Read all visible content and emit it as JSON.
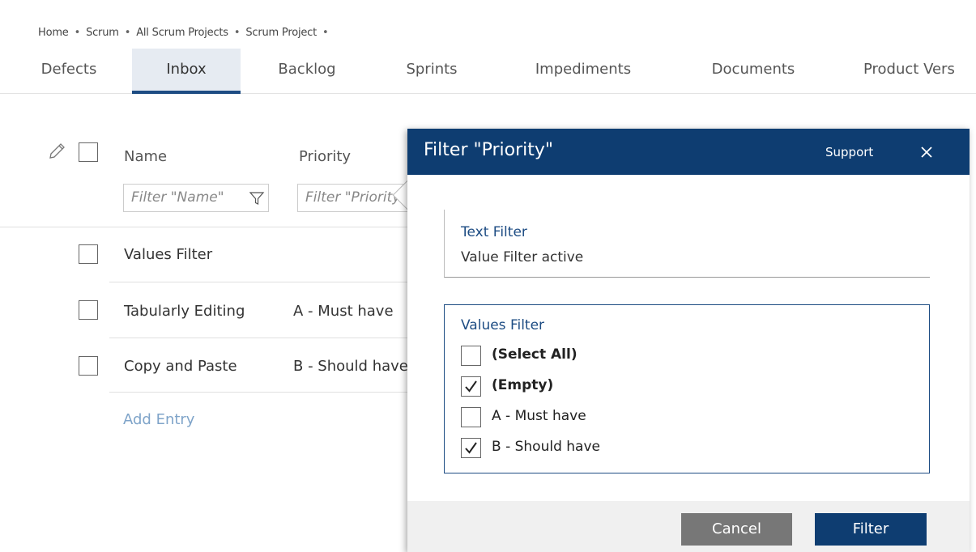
{
  "breadcrumb": [
    "Home",
    "Scrum",
    "All Scrum Projects",
    "Scrum Project"
  ],
  "tabs": [
    {
      "label": "Defects"
    },
    {
      "label": "Inbox",
      "active": true
    },
    {
      "label": "Backlog"
    },
    {
      "label": "Sprints"
    },
    {
      "label": "Impediments"
    },
    {
      "label": "Documents"
    },
    {
      "label": "Product Vers"
    }
  ],
  "grid": {
    "columns": [
      {
        "label": "Name",
        "filter_placeholder": "Filter \"Name\""
      },
      {
        "label": "Priority",
        "filter_placeholder": "Filter \"Priority\""
      }
    ],
    "rows": [
      {
        "name": "Values Filter",
        "priority": ""
      },
      {
        "name": "Tabularly Editing",
        "priority": "A - Must have"
      },
      {
        "name": "Copy and Paste",
        "priority": "B - Should have"
      }
    ],
    "add_entry": "Add Entry"
  },
  "dialog": {
    "title": "Filter \"Priority\"",
    "support": "Support",
    "text_filter": {
      "label": "Text Filter",
      "value": "Value Filter active"
    },
    "values_filter": {
      "label": "Values Filter",
      "options": [
        {
          "label": "(Select All)",
          "checked": false,
          "bold": true
        },
        {
          "label": "(Empty)",
          "checked": true,
          "bold": true
        },
        {
          "label": "A - Must have",
          "checked": false,
          "bold": false
        },
        {
          "label": "B - Should have",
          "checked": true,
          "bold": false
        }
      ]
    },
    "buttons": {
      "cancel": "Cancel",
      "filter": "Filter"
    }
  },
  "colors": {
    "accent": "#0e3d71",
    "link": "#7fa4c9",
    "tab_active_bg": "#e6ebf2"
  }
}
